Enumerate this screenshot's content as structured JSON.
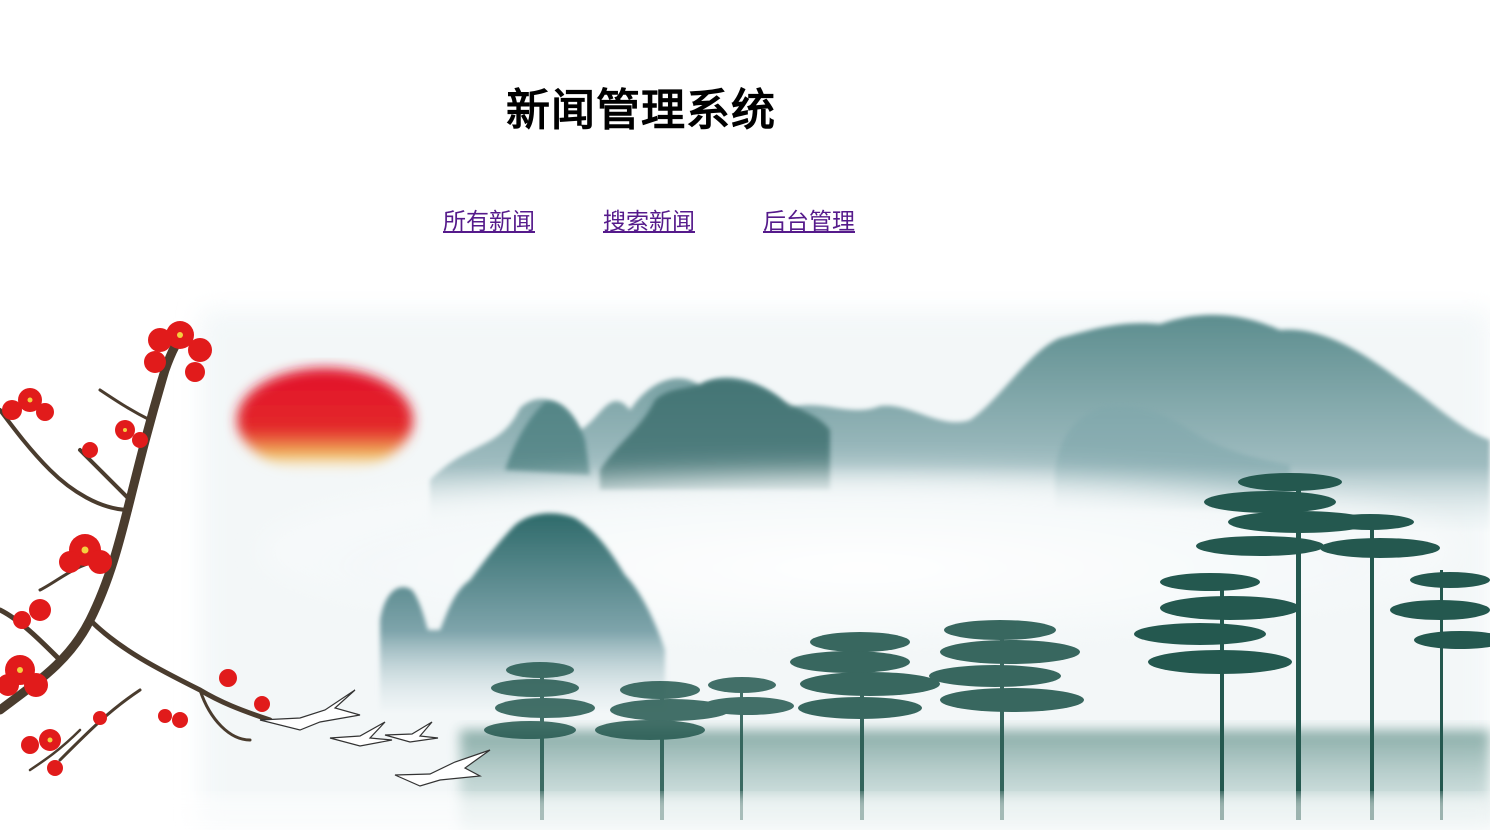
{
  "header": {
    "title": "新闻管理系统"
  },
  "nav": {
    "items": [
      {
        "label": "所有新闻"
      },
      {
        "label": "搜索新闻"
      },
      {
        "label": "后台管理"
      }
    ]
  },
  "colors": {
    "link": "#551a8b",
    "title": "#000000",
    "sun": "#e0102a",
    "blossom": "#e11b1b",
    "pine": "#1f5a50",
    "mist": "#dfeaec"
  },
  "banner": {
    "icons": [
      "plum-blossom-icon",
      "sun-icon",
      "crane-icon",
      "pine-tree-icon",
      "mountain-icon"
    ]
  }
}
